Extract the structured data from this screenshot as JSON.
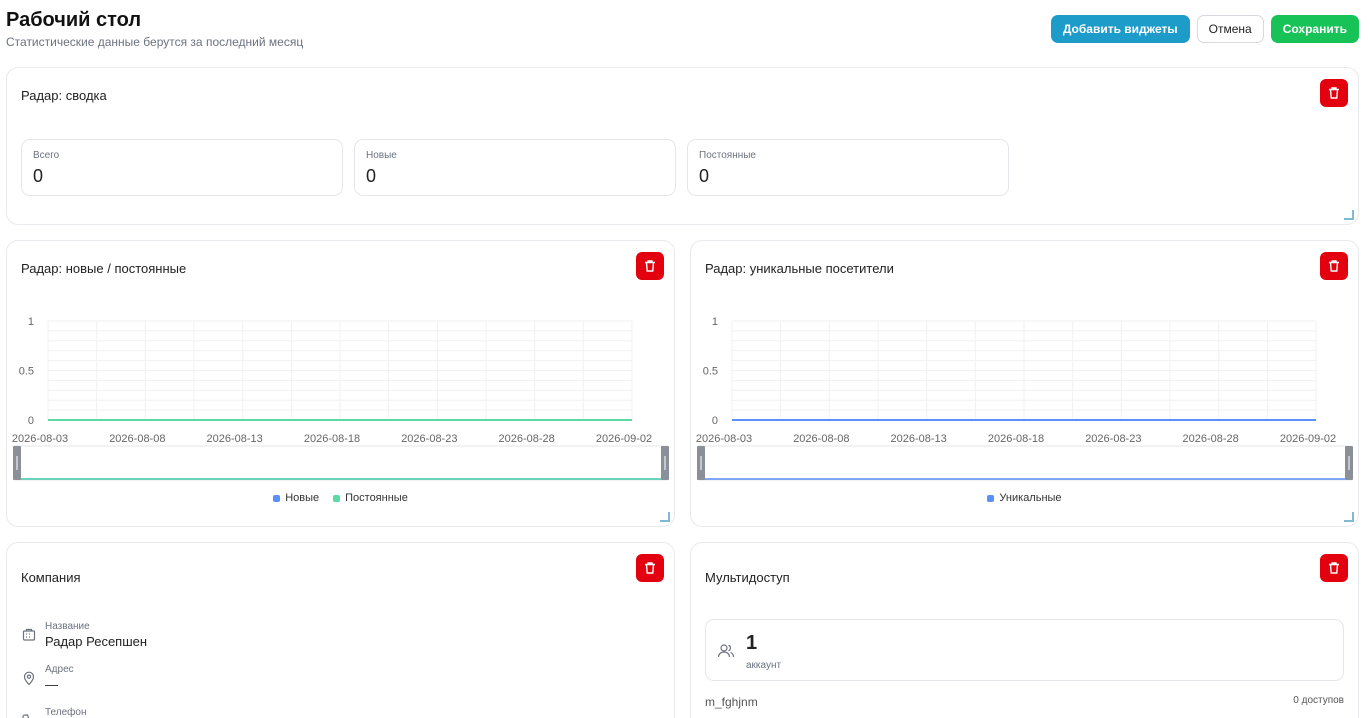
{
  "header": {
    "title": "Рабочий стол",
    "subtitle": "Статистические данные берутся за последний месяц",
    "add_widgets": "Добавить виджеты",
    "cancel": "Отмена",
    "save": "Сохранить"
  },
  "summary": {
    "title": "Радар: сводка",
    "stats": [
      {
        "label": "Всего",
        "value": "0"
      },
      {
        "label": "Новые",
        "value": "0"
      },
      {
        "label": "Постоянные",
        "value": "0"
      }
    ]
  },
  "new_returning": {
    "title": "Радар: новые / постоянные"
  },
  "unique": {
    "title": "Радар: уникальные посетители"
  },
  "chart_data": [
    {
      "type": "line",
      "x": [
        "2026-08-03",
        "2026-08-08",
        "2026-08-13",
        "2026-08-18",
        "2026-08-23",
        "2026-08-28",
        "2026-09-02"
      ],
      "y_ticks": [
        "0",
        "0.5",
        "1"
      ],
      "ylim": [
        0,
        1
      ],
      "series": [
        {
          "name": "Новые",
          "color": "#5b8ff9",
          "values": [
            0,
            0,
            0,
            0,
            0,
            0,
            0
          ]
        },
        {
          "name": "Постоянные",
          "color": "#5ad8a6",
          "values": [
            0,
            0,
            0,
            0,
            0,
            0,
            0
          ]
        }
      ],
      "legend": "bottom"
    },
    {
      "type": "line",
      "x": [
        "2026-08-03",
        "2026-08-08",
        "2026-08-13",
        "2026-08-18",
        "2026-08-23",
        "2026-08-28",
        "2026-09-02"
      ],
      "y_ticks": [
        "0",
        "0.5",
        "1"
      ],
      "ylim": [
        0,
        1
      ],
      "series": [
        {
          "name": "Уникальные",
          "color": "#5b8ff9",
          "values": [
            0,
            0,
            0,
            0,
            0,
            0,
            0
          ]
        }
      ],
      "legend": "bottom"
    }
  ],
  "company": {
    "title": "Компания",
    "name_label": "Название",
    "name_value": "Радар Ресепшен",
    "address_label": "Адрес",
    "address_value": "—",
    "phone_label": "Телефон"
  },
  "multiaccess": {
    "title": "Мультидоступ",
    "count": "1",
    "unit": "аккаунт",
    "login": "m_fghjnm",
    "access": "0 доступов"
  },
  "icons": {
    "delete": "trash-icon",
    "building": "building-icon",
    "location": "map-pin-icon",
    "phone": "phone-icon",
    "users": "users-icon"
  },
  "colors": {
    "primary": "#1d9bc9",
    "success": "#17c257",
    "danger": "#e3000f"
  }
}
